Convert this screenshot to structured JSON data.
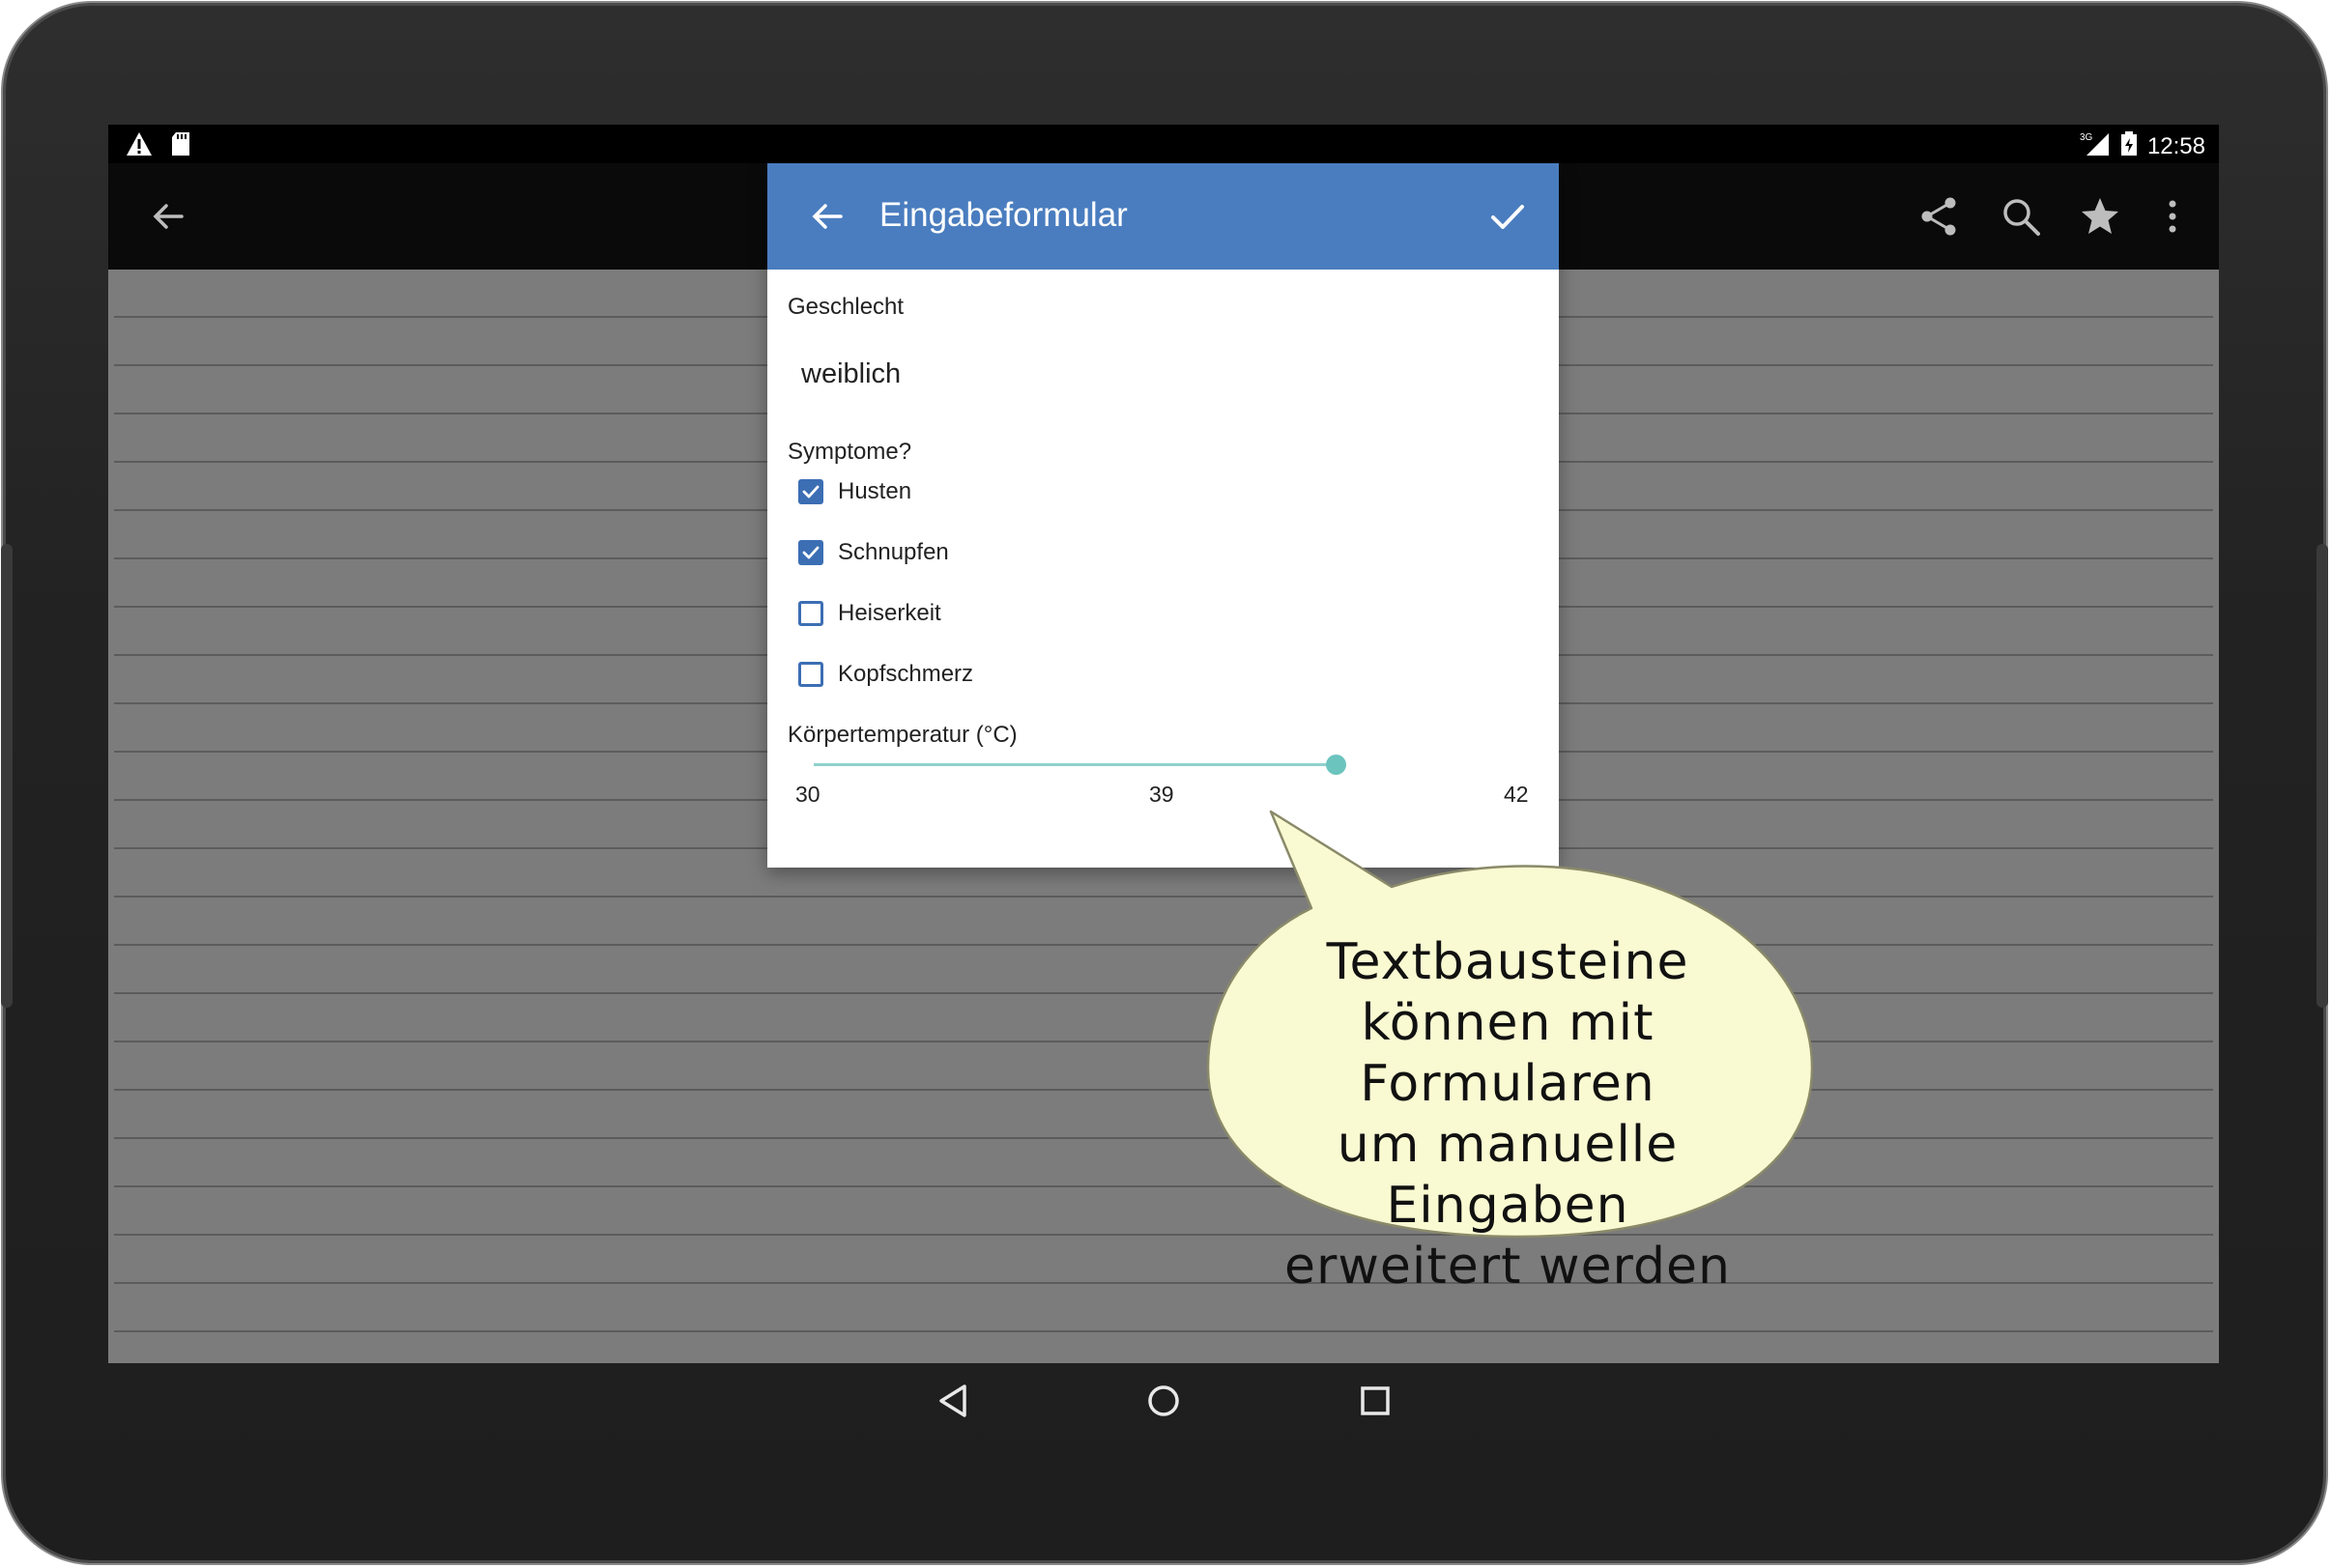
{
  "status_bar": {
    "left_icons": [
      "warning-icon",
      "sd-card-icon"
    ],
    "network": "3G",
    "time": "12:58"
  },
  "toolbar": {
    "icons": [
      "back-arrow-icon",
      "share-icon",
      "search-icon",
      "star-icon",
      "more-vert-icon"
    ]
  },
  "dialog": {
    "title": "Eingabeformular",
    "fields": {
      "gender_label": "Geschlecht",
      "gender_value": "weiblich",
      "symptoms_label": "Symptome?",
      "symptoms": [
        {
          "label": "Husten",
          "checked": true
        },
        {
          "label": "Schnupfen",
          "checked": true
        },
        {
          "label": "Heiserkeit",
          "checked": false
        },
        {
          "label": "Kopfschmerz",
          "checked": false
        }
      ],
      "temperature_label": "Körpertemperatur (°C)",
      "temperature_min": "30",
      "temperature_value": "39",
      "temperature_max": "42"
    }
  },
  "callout": {
    "lines": [
      "Textbausteine",
      "können mit Formularen",
      "um manuelle Eingaben",
      "erweitert werden"
    ]
  },
  "nav_bar": {
    "icons": [
      "nav-back-icon",
      "nav-home-icon",
      "nav-recents-icon"
    ]
  },
  "colors": {
    "dialog_header": "#4a7dbf",
    "checkbox": "#3c6eb4",
    "slider": "#6cc4bf",
    "callout_fill": "#fafad2",
    "content_bg": "#7c7c7c"
  }
}
